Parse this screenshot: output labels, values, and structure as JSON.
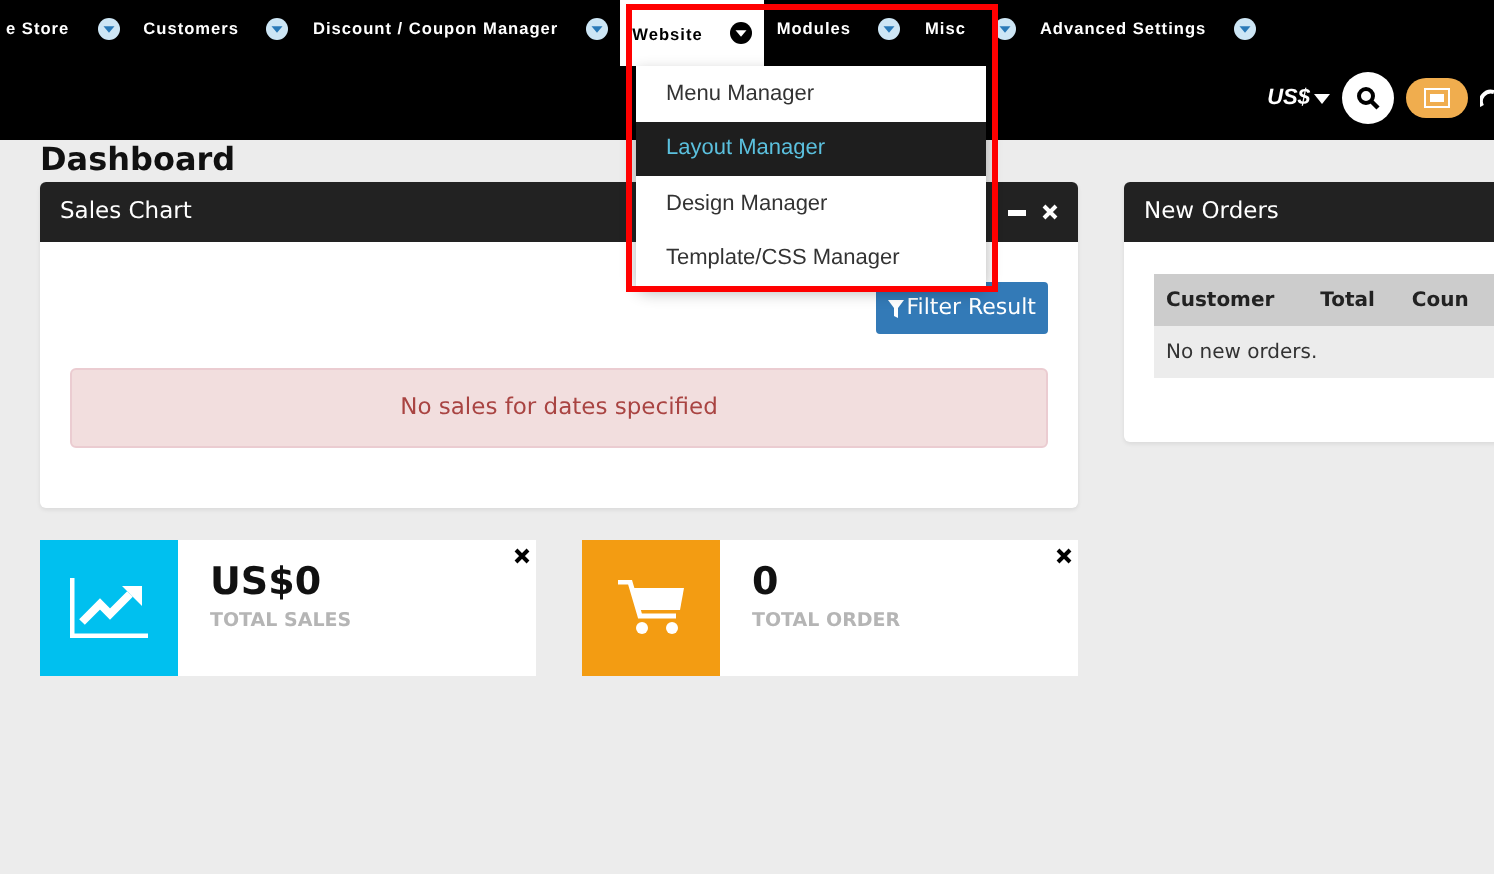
{
  "nav": {
    "items": [
      {
        "label": "e Store",
        "selected": false
      },
      {
        "label": "Customers",
        "selected": false
      },
      {
        "label": "Discount / Coupon Manager",
        "selected": false
      },
      {
        "label": "Website",
        "selected": true
      },
      {
        "label": "Modules",
        "selected": false
      },
      {
        "label": "Misc",
        "selected": false
      },
      {
        "label": "Advanced Settings",
        "selected": false
      }
    ],
    "currency": "US$"
  },
  "dropdown": {
    "items": [
      {
        "label": "Menu Manager",
        "selected": false
      },
      {
        "label": "Layout Manager",
        "selected": true
      },
      {
        "label": "Design Manager",
        "selected": false
      },
      {
        "label": "Template/CSS Manager",
        "selected": false
      }
    ]
  },
  "page_title": "Dashboard",
  "sales_chart": {
    "title": "Sales Chart",
    "filter_button": "Filter Result",
    "alert": "No sales for dates specified"
  },
  "stats": [
    {
      "kind": "sales",
      "value": "US$0",
      "label": "TOTAL SALES"
    },
    {
      "kind": "orders",
      "value": "0",
      "label": "TOTAL ORDER"
    }
  ],
  "new_orders": {
    "title": "New Orders",
    "columns": [
      "Customer",
      "Total",
      "Coun"
    ],
    "empty_text": "No new orders."
  }
}
